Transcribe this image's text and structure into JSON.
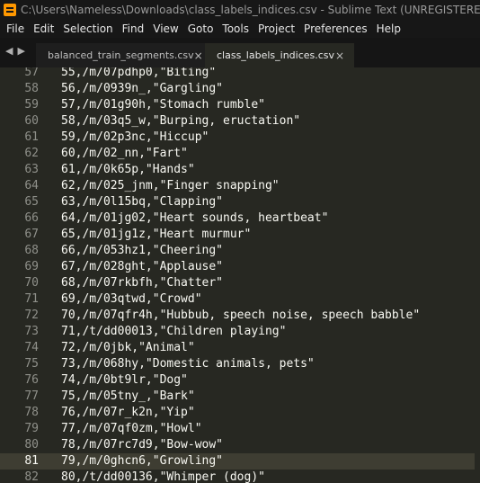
{
  "window": {
    "title": "C:\\Users\\Nameless\\Downloads\\class_labels_indices.csv - Sublime Text (UNREGISTERED)"
  },
  "menu": [
    "File",
    "Edit",
    "Selection",
    "Find",
    "View",
    "Goto",
    "Tools",
    "Project",
    "Preferences",
    "Help"
  ],
  "tabs": [
    {
      "label": "balanced_train_segments.csv",
      "close": "×",
      "active": false
    },
    {
      "label": "class_labels_indices.csv",
      "close": "×",
      "active": true
    }
  ],
  "nav_arrows": {
    "back": "◀",
    "forward": "▶"
  },
  "editor": {
    "current_line": "81",
    "lines": [
      {
        "num": "57",
        "text": "55,/m/07pdhp0,\"Biting\""
      },
      {
        "num": "58",
        "text": "56,/m/0939n_,\"Gargling\""
      },
      {
        "num": "59",
        "text": "57,/m/01g90h,\"Stomach rumble\""
      },
      {
        "num": "60",
        "text": "58,/m/03q5_w,\"Burping, eructation\""
      },
      {
        "num": "61",
        "text": "59,/m/02p3nc,\"Hiccup\""
      },
      {
        "num": "62",
        "text": "60,/m/02_nn,\"Fart\""
      },
      {
        "num": "63",
        "text": "61,/m/0k65p,\"Hands\""
      },
      {
        "num": "64",
        "text": "62,/m/025_jnm,\"Finger snapping\""
      },
      {
        "num": "65",
        "text": "63,/m/0l15bq,\"Clapping\""
      },
      {
        "num": "66",
        "text": "64,/m/01jg02,\"Heart sounds, heartbeat\""
      },
      {
        "num": "67",
        "text": "65,/m/01jg1z,\"Heart murmur\""
      },
      {
        "num": "68",
        "text": "66,/m/053hz1,\"Cheering\""
      },
      {
        "num": "69",
        "text": "67,/m/028ght,\"Applause\""
      },
      {
        "num": "70",
        "text": "68,/m/07rkbfh,\"Chatter\""
      },
      {
        "num": "71",
        "text": "69,/m/03qtwd,\"Crowd\""
      },
      {
        "num": "72",
        "text": "70,/m/07qfr4h,\"Hubbub, speech noise, speech babble\""
      },
      {
        "num": "73",
        "text": "71,/t/dd00013,\"Children playing\""
      },
      {
        "num": "74",
        "text": "72,/m/0jbk,\"Animal\""
      },
      {
        "num": "75",
        "text": "73,/m/068hy,\"Domestic animals, pets\""
      },
      {
        "num": "76",
        "text": "74,/m/0bt9lr,\"Dog\""
      },
      {
        "num": "77",
        "text": "75,/m/05tny_,\"Bark\""
      },
      {
        "num": "78",
        "text": "76,/m/07r_k2n,\"Yip\""
      },
      {
        "num": "79",
        "text": "77,/m/07qf0zm,\"Howl\""
      },
      {
        "num": "80",
        "text": "78,/m/07rc7d9,\"Bow-wow\""
      },
      {
        "num": "81",
        "text": "79,/m/0ghcn6,\"Growling\""
      },
      {
        "num": "82",
        "text": "80,/t/dd00136,\"Whimper (dog)\""
      }
    ]
  }
}
